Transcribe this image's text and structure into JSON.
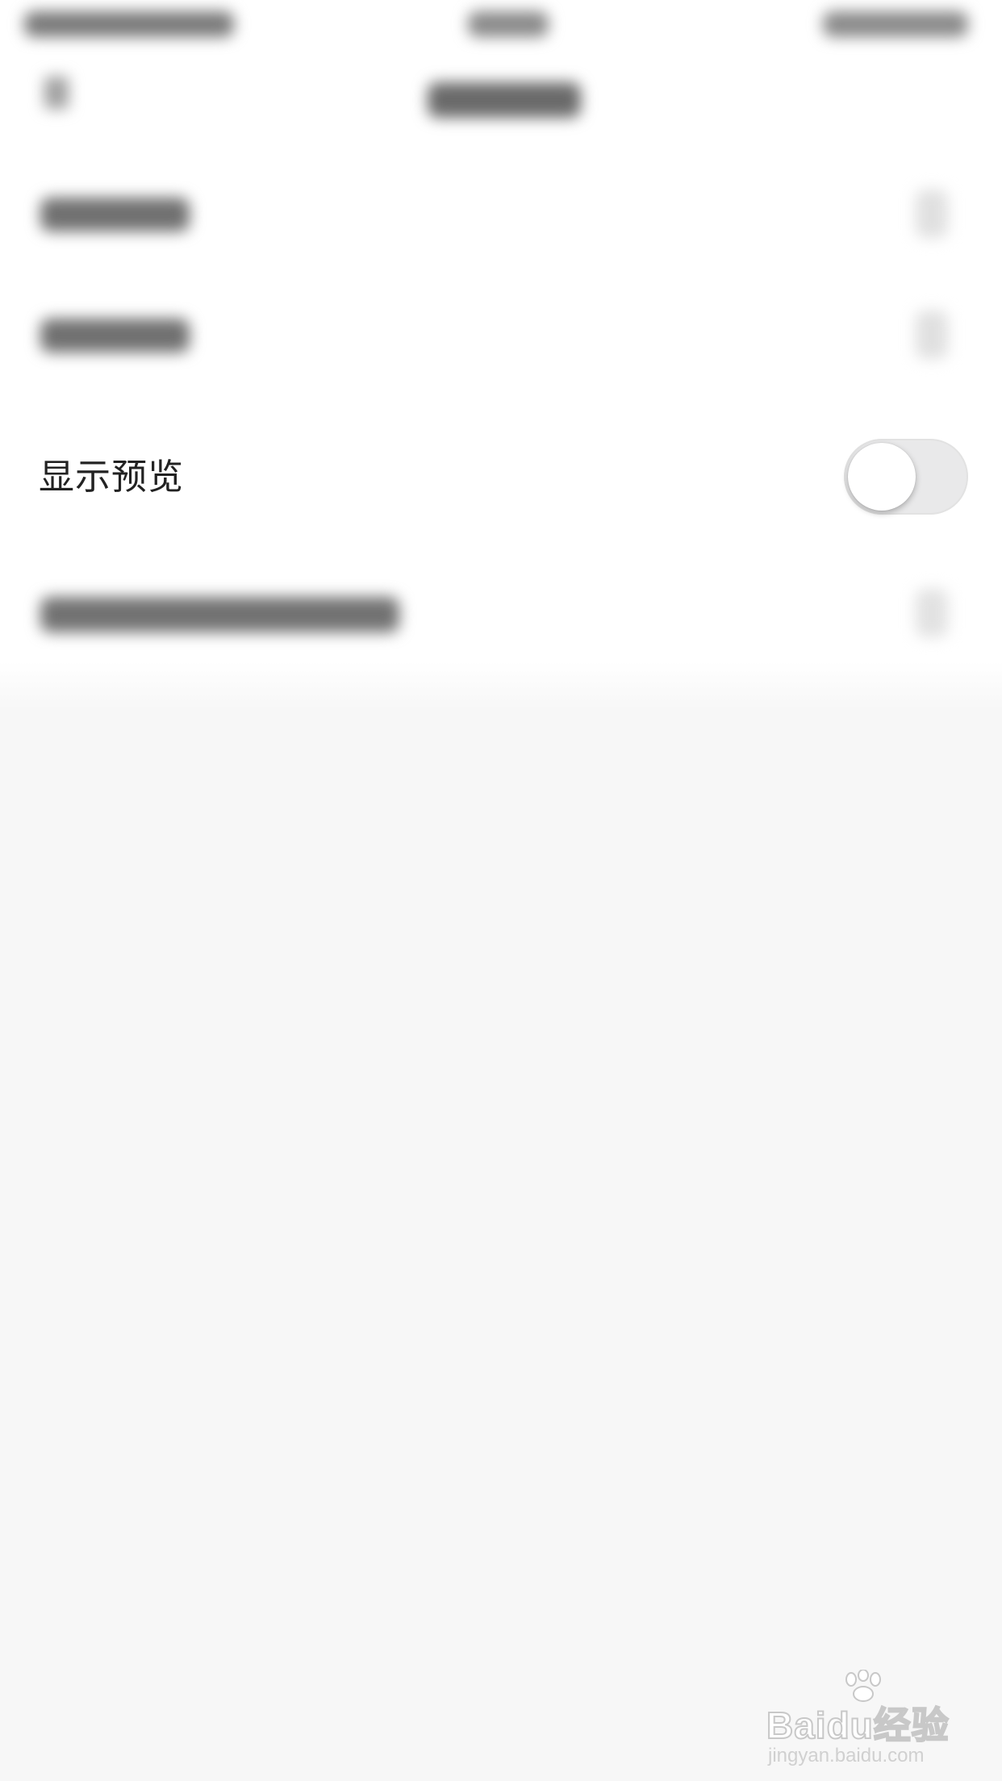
{
  "settings": {
    "preview_row": {
      "label": "显示预览",
      "toggle_on": false
    }
  },
  "watermark": {
    "brand": "Baidu经验",
    "url": "jingyan.baidu.com"
  },
  "colors": {
    "background": "#f7f7f7",
    "row_background": "#ffffff",
    "toggle_off": "#e9e9ea",
    "label_text": "#222222"
  }
}
